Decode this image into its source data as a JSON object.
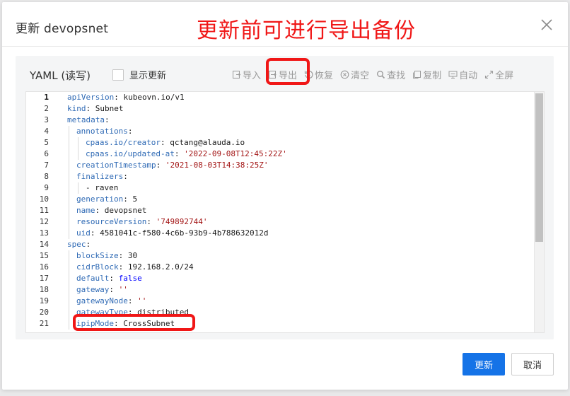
{
  "dialog": {
    "title": "更新 devopsnet",
    "annotation": "更新前可进行导出备份"
  },
  "editor": {
    "label": "YAML (读写)",
    "show_changes_label": "显示更新",
    "toolbar": [
      {
        "label": "导入",
        "icon": "import-icon"
      },
      {
        "label": "导出",
        "icon": "export-icon"
      },
      {
        "label": "恢复",
        "icon": "restore-icon"
      },
      {
        "label": "清空",
        "icon": "clear-icon"
      },
      {
        "label": "查找",
        "icon": "search-icon"
      },
      {
        "label": "复制",
        "icon": "copy-icon"
      },
      {
        "label": "自动",
        "icon": "auto-icon"
      },
      {
        "label": "全屏",
        "icon": "fullscreen-icon"
      }
    ],
    "lines": [
      {
        "n": "1",
        "indent": 0,
        "key": "apiVersion",
        "val": "kubeovn.io/v1",
        "vt": "v"
      },
      {
        "n": "2",
        "indent": 0,
        "key": "kind",
        "val": "Subnet",
        "vt": "v"
      },
      {
        "n": "3",
        "indent": 0,
        "key": "metadata",
        "val": "",
        "vt": "v"
      },
      {
        "n": "4",
        "indent": 1,
        "key": "annotations",
        "val": "",
        "vt": "v"
      },
      {
        "n": "5",
        "indent": 2,
        "key": "cpaas.io/creator",
        "val": "qctang@alauda.io",
        "vt": "v"
      },
      {
        "n": "6",
        "indent": 2,
        "key": "cpaas.io/updated-at",
        "val": "'2022-09-08T12:45:22Z'",
        "vt": "s"
      },
      {
        "n": "7",
        "indent": 1,
        "key": "creationTimestamp",
        "val": "'2021-08-03T14:38:25Z'",
        "vt": "s"
      },
      {
        "n": "8",
        "indent": 1,
        "key": "finalizers",
        "val": "",
        "vt": "v"
      },
      {
        "n": "9",
        "indent": 2,
        "key": "",
        "val": "- raven",
        "vt": "p"
      },
      {
        "n": "10",
        "indent": 1,
        "key": "generation",
        "val": "5",
        "vt": "v"
      },
      {
        "n": "11",
        "indent": 1,
        "key": "name",
        "val": "devopsnet",
        "vt": "v"
      },
      {
        "n": "12",
        "indent": 1,
        "key": "resourceVersion",
        "val": "'749892744'",
        "vt": "s"
      },
      {
        "n": "13",
        "indent": 1,
        "key": "uid",
        "val": "4581041c-f580-4c6b-93b9-4b788632012d",
        "vt": "v"
      },
      {
        "n": "14",
        "indent": 0,
        "key": "spec",
        "val": "",
        "vt": "v"
      },
      {
        "n": "15",
        "indent": 1,
        "key": "blockSize",
        "val": "30",
        "vt": "v"
      },
      {
        "n": "16",
        "indent": 1,
        "key": "cidrBlock",
        "val": "192.168.2.0/24",
        "vt": "v"
      },
      {
        "n": "17",
        "indent": 1,
        "key": "default",
        "val": "false",
        "vt": "b"
      },
      {
        "n": "18",
        "indent": 1,
        "key": "gateway",
        "val": "''",
        "vt": "s"
      },
      {
        "n": "19",
        "indent": 1,
        "key": "gatewayNode",
        "val": "''",
        "vt": "s"
      },
      {
        "n": "20",
        "indent": 1,
        "key": "gatewayType",
        "val": "distributed",
        "vt": "v"
      },
      {
        "n": "21",
        "indent": 1,
        "key": "ipipMode",
        "val": "CrossSubnet",
        "vt": "v"
      }
    ]
  },
  "footer": {
    "update_label": "更新",
    "cancel_label": "取消"
  },
  "colors": {
    "primary": "#1573e7",
    "highlight": "#f01717"
  }
}
